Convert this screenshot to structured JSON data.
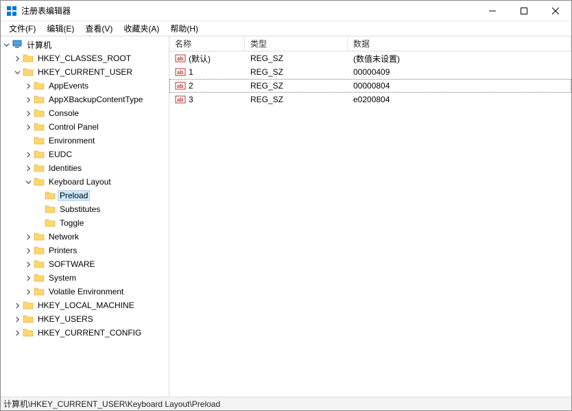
{
  "window": {
    "title": "注册表编辑器"
  },
  "menu": {
    "file": "文件(F)",
    "edit": "编辑(E)",
    "view": "查看(V)",
    "favorites": "收藏夹(A)",
    "help": "帮助(H)"
  },
  "tree": {
    "root": "计算机",
    "hkcr": "HKEY_CLASSES_ROOT",
    "hkcu": "HKEY_CURRENT_USER",
    "hkcu_children": {
      "appevents": "AppEvents",
      "appxbackup": "AppXBackupContentType",
      "console": "Console",
      "controlpanel": "Control Panel",
      "environment": "Environment",
      "eudc": "EUDC",
      "identities": "Identities",
      "keyboardlayout": "Keyboard Layout",
      "kl_preload": "Preload",
      "kl_substitutes": "Substitutes",
      "kl_toggle": "Toggle",
      "network": "Network",
      "printers": "Printers",
      "software": "SOFTWARE",
      "system": "System",
      "volatileenv": "Volatile Environment"
    },
    "hklm": "HKEY_LOCAL_MACHINE",
    "hku": "HKEY_USERS",
    "hkcc": "HKEY_CURRENT_CONFIG"
  },
  "list": {
    "columns": {
      "name": "名称",
      "type": "类型",
      "data": "数据"
    },
    "rows": [
      {
        "name": "(默认)",
        "type": "REG_SZ",
        "data": "(数值未设置)",
        "selected": false
      },
      {
        "name": "1",
        "type": "REG_SZ",
        "data": "00000409",
        "selected": false
      },
      {
        "name": "2",
        "type": "REG_SZ",
        "data": "00000804",
        "selected": true
      },
      {
        "name": "3",
        "type": "REG_SZ",
        "data": "e0200804",
        "selected": false
      }
    ]
  },
  "status": {
    "path": "计算机\\HKEY_CURRENT_USER\\Keyboard Layout\\Preload"
  }
}
